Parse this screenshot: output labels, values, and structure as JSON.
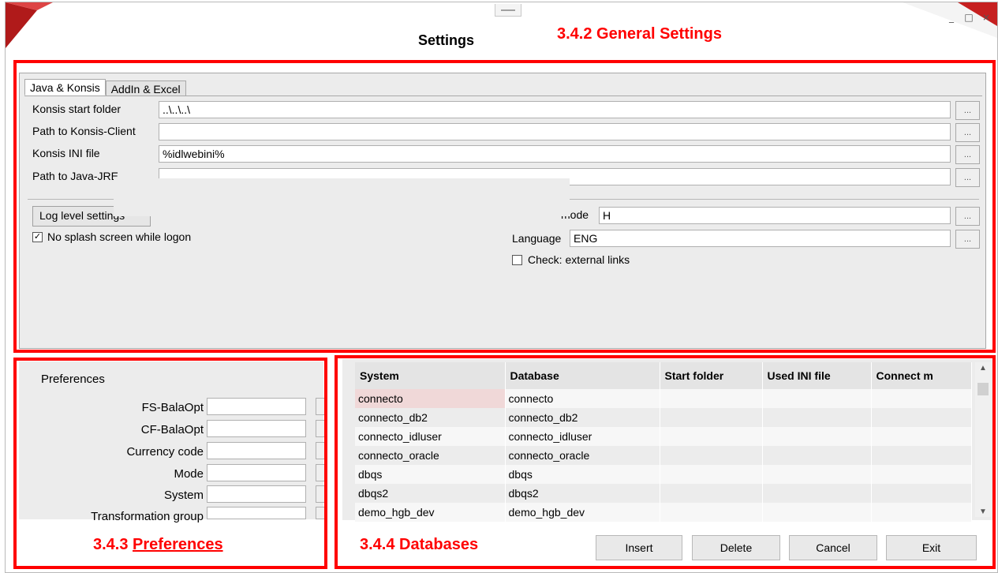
{
  "window": {
    "title": "Settings",
    "controls": {
      "minimize": "_",
      "maximize": "□",
      "close": "×"
    },
    "accent_color": "#b01a1a"
  },
  "annotations": {
    "general": "3.4.2 General Settings",
    "preferences_prefix": "3.4.3 ",
    "preferences_link": "Preferences",
    "databases": "3.4.4 Databases"
  },
  "general": {
    "tabs": [
      {
        "label": "Java & Konsis",
        "active": true
      },
      {
        "label": "AddIn & Excel",
        "active": false
      }
    ],
    "fields": [
      {
        "label": "Konsis start folder",
        "value": "..\\..\\..\\"
      },
      {
        "label": "Path to Konsis-Client",
        "value": ""
      },
      {
        "label": "Konsis INI file",
        "value": "%idlwebini%"
      },
      {
        "label": "Path to Java-JRE",
        "value": ""
      }
    ],
    "dots_label": "...",
    "log_button_label": "Log level settings",
    "no_splash_label": "No splash screen while logon",
    "no_splash_checked": true,
    "mode_label": "mode",
    "mode_value": "H",
    "language_label": "Language",
    "language_value": "ENG",
    "check_external_label": "Check: external links",
    "check_external_checked": false
  },
  "preferences": {
    "heading": "Preferences",
    "items": [
      {
        "label": "FS-BalaOpt"
      },
      {
        "label": "CF-BalaOpt"
      },
      {
        "label": "Currency code"
      },
      {
        "label": "Mode"
      },
      {
        "label": "System"
      },
      {
        "label": "Transformation group"
      }
    ]
  },
  "databases": {
    "columns": [
      "System",
      "Database",
      "Start folder",
      "Used INI file",
      "Connect m"
    ],
    "rows": [
      [
        "connecto",
        "connecto",
        "",
        "",
        ""
      ],
      [
        "connecto_db2",
        "connecto_db2",
        "",
        "",
        ""
      ],
      [
        "connecto_idluser",
        "connecto_idluser",
        "",
        "",
        ""
      ],
      [
        "connecto_oracle",
        "connecto_oracle",
        "",
        "",
        ""
      ],
      [
        "dbqs",
        "dbqs",
        "",
        "",
        ""
      ],
      [
        "dbqs2",
        "dbqs2",
        "",
        "",
        ""
      ],
      [
        "demo_hgb_dev",
        "demo_hgb_dev",
        "",
        "",
        ""
      ]
    ],
    "buttons": {
      "insert": "Insert",
      "delete": "Delete",
      "cancel": "Cancel",
      "exit": "Exit"
    }
  }
}
